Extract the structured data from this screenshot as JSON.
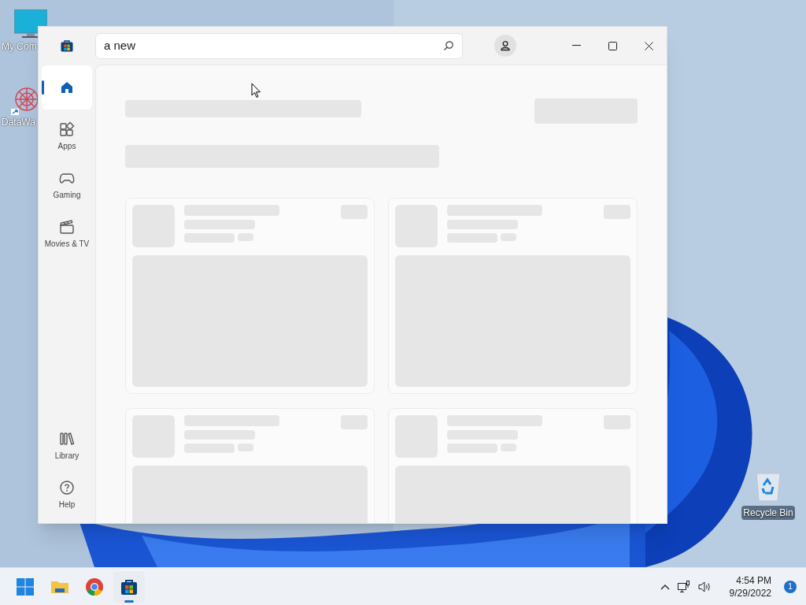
{
  "desktop_icons": [
    {
      "label": "My Com"
    },
    {
      "label": "DataWa"
    },
    {
      "label": "Recycle Bin"
    }
  ],
  "window": {
    "search": {
      "value": "a new"
    }
  },
  "sidebar": {
    "items": [
      {
        "selected": true
      },
      {
        "label": "Apps",
        "selected": false
      },
      {
        "label": "Gaming",
        "selected": false
      },
      {
        "label": "Movies & TV",
        "selected": false
      },
      {
        "label": "Library",
        "selected": false
      },
      {
        "label": "Help",
        "selected": false
      }
    ]
  },
  "taskbar": {
    "apps": [
      {
        "selected": false
      },
      {
        "selected": false
      },
      {
        "selected": false
      },
      {
        "selected": true
      }
    ],
    "time": "4:54 PM",
    "date": "9/29/2022",
    "notifications": "1"
  }
}
